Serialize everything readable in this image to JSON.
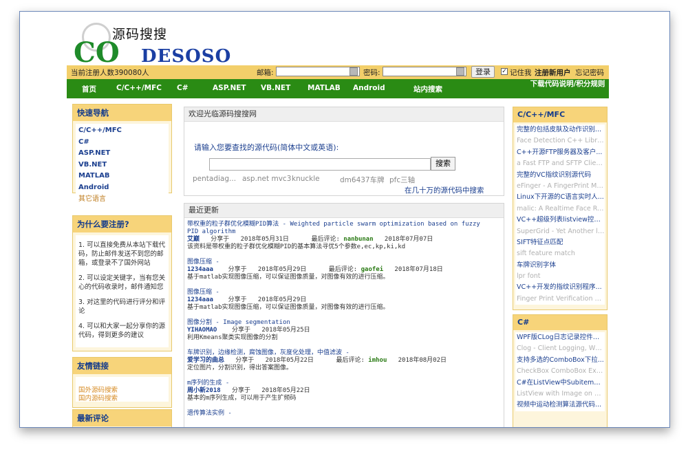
{
  "logo": {
    "cn": "源码搜搜",
    "en_a": "CO",
    "en_b": "DESOSO"
  },
  "loginbar": {
    "count": "当前注册人数390080人",
    "email_label": "邮箱:",
    "password_label": "密码:",
    "login_button": "登录",
    "remember": "记住我",
    "register": "注册新用户",
    "forgot": "忘记密码"
  },
  "nav": {
    "items": [
      "首页",
      "C/C++/MFC",
      "C#",
      "ASP.NET",
      "VB.NET",
      "MATLAB",
      "Android",
      "站内搜索"
    ],
    "right": "下载代码说明/积分规则"
  },
  "sidebar": {
    "quick": {
      "title": "快速导航",
      "items": [
        "C/C++/MFC",
        "C#",
        "ASP.NET",
        "VB.NET",
        "MATLAB",
        "Android",
        "其它语言"
      ]
    },
    "why": {
      "title": "为什么要注册?",
      "items": [
        "1. 可以直接免费从本站下载代码，防止邮件发送不到您的邮箱，或登录不了国外网站",
        "2. 可以设定关键字，当有您关心的代码收录时，邮件通知您",
        "3. 对这里的代码进行评分和评论",
        "4. 可以和大家一起分享你的源代码，得到更多的建议"
      ]
    },
    "links": {
      "title": "友情链接",
      "items": [
        "国外源码搜索",
        "国内源码搜索"
      ]
    },
    "latest": {
      "title": "最新评论"
    }
  },
  "search": {
    "title": "欢迎光临源码搜搜网",
    "prompt": "请输入您要查找的源代码(简体中文或英语):",
    "button": "搜索",
    "tags": [
      "pentadiag...",
      "asp.net mvc3",
      "knuckle",
      "dm6437车牌",
      "pfc三轴"
    ],
    "tagline": "在几十万的源代码中搜索"
  },
  "recent": {
    "title": "最近更新",
    "items": [
      {
        "title": "带权重的粒子群优化模糊PID算法 - Weighted particle swarm optimization based on fuzzy PID algorithm",
        "user": "艾巅",
        "shared": "分享于",
        "date": "2018年05月31日",
        "comment_label": "最后评论:",
        "commenter": "nanbunan",
        "comment_date": "2018年07月07日",
        "desc": "该资料是带权重的粒子群优化模糊PID的基本算法寻优5个参数e,ec,kp,ki,kd"
      },
      {
        "title": "图像压缩 -",
        "user": "1234aaa",
        "shared": "分享于",
        "date": "2018年05月29日",
        "comment_label": "最后评论:",
        "commenter": "gaofei",
        "comment_date": "2018年07月18日",
        "desc": "基于matlab实现图像压缩，可以保证图像质量，对图像有效的进行压缩。"
      },
      {
        "title": "图像压缩 -",
        "user": "1234aaa",
        "shared": "分享于",
        "date": "2018年05月29日",
        "comment_label": "",
        "commenter": "",
        "comment_date": "",
        "desc": "基于matlab实现图像压缩，可以保证图像质量，对图像有效的进行压缩。"
      },
      {
        "title": "图像分割 - Image segmentation",
        "user": "YIHAOMAO",
        "shared": "分享于",
        "date": "2018年05月25日",
        "comment_label": "",
        "commenter": "",
        "comment_date": "",
        "desc": "利用Kmeans聚类实现图像的分割"
      },
      {
        "title": "车牌识别，边缘检测，腐蚀图像，灰度化处理，中值滤波 -",
        "user": "爱学习的曲总",
        "shared": "分享于",
        "date": "2018年05月22日",
        "comment_label": "最后评论:",
        "commenter": "imhou",
        "comment_date": "2018年08月02日",
        "desc": "定位图片，分割识别，得出答案图像。"
      },
      {
        "title": "m序列的生成 -",
        "user": "周小新2018",
        "shared": "分享于",
        "date": "2018年05月22日",
        "comment_label": "",
        "commenter": "",
        "comment_date": "",
        "desc": "基本的m序列生成，可以用于产生扩频码"
      },
      {
        "title": "遗传算法实例 -",
        "user": "",
        "shared": "",
        "date": "",
        "comment_label": "",
        "commenter": "",
        "comment_date": "",
        "desc": ""
      }
    ]
  },
  "right": {
    "cpp": {
      "title": "C/C++/MFC",
      "items": [
        {
          "t": "完整的包括皮肤及动作识别...",
          "s": "Face Detection C++ Library..."
        },
        {
          "t": "C++开源FTP服务器及客户...",
          "s": "a Fast FTP and SFTP Client ..."
        },
        {
          "t": "完整的VC指纹识别源代码",
          "s": "eFinger - A FingerPrint Matc..."
        },
        {
          "t": "Linux下开源的C语言实时人...",
          "s": "malic: A Realtime Face Recog..."
        },
        {
          "t": "VC++超级列表listview控件...",
          "s": "SuperGrid - Yet Another listvi..."
        },
        {
          "t": "SIFT特征点匹配",
          "s": "sift feature match"
        },
        {
          "t": "车牌识别字体",
          "s": "lpr font"
        },
        {
          "t": "VC++开发的指纹识别程序...",
          "s": "Finger Print Verification Syst..."
        }
      ]
    },
    "cs": {
      "title": "C#",
      "items": [
        {
          "t": "WPF版CLog日志记录控件源...",
          "s": "Clog - Client Logging, WPF ..."
        },
        {
          "t": "支持多选的ComboBox下拉...",
          "s": "CheckBox ComboBox Extendi..."
        },
        {
          "t": "C#在ListView中Subitem显...",
          "s": "ListView with Image on SubIt..."
        },
        {
          "t": "视频中运动检测算法源代码...",
          "s": ""
        }
      ]
    }
  }
}
